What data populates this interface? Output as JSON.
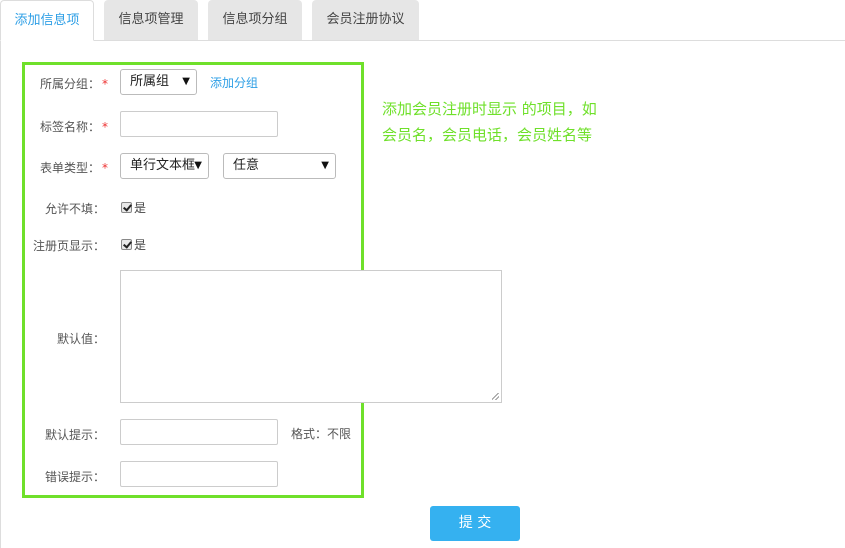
{
  "tabs": [
    {
      "label": "添加信息项",
      "active": true
    },
    {
      "label": "信息项管理",
      "active": false
    },
    {
      "label": "信息项分组",
      "active": false
    },
    {
      "label": "会员注册协议",
      "active": false
    }
  ],
  "form": {
    "group": {
      "label": "所属分组：",
      "required": "*",
      "value": "所属组",
      "add_link": "添加分组"
    },
    "tag_name": {
      "label": "标签名称：",
      "required": "*",
      "value": ""
    },
    "form_type": {
      "label": "表单类型：",
      "required": "*",
      "type_value": "单行文本框",
      "rule_value": "任意"
    },
    "allow_empty": {
      "label": "允许不填：",
      "checked": true,
      "option": "是"
    },
    "show_on_register": {
      "label": "注册页显示：",
      "checked": true,
      "option": "是"
    },
    "default_value": {
      "label": "默认值：",
      "value": ""
    },
    "default_hint": {
      "label": "默认提示：",
      "value": "",
      "format": "格式：不限"
    },
    "error_hint": {
      "label": "错误提示：",
      "value": ""
    }
  },
  "note": "添加会员注册时显示 的项目，如会员名，会员电话，会员姓名等",
  "submit_label": "提 交",
  "colors": {
    "accent": "#2e9fe6",
    "highlight": "#6fe02a",
    "button": "#35b1f0",
    "required": "#e33333"
  }
}
